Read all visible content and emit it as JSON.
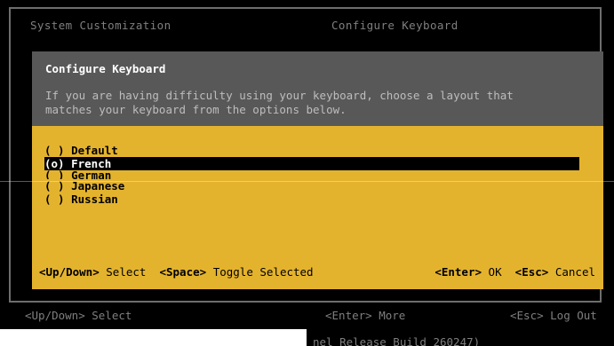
{
  "header": {
    "left_title": "System Customization",
    "right_title": "Configure Keyboard"
  },
  "dialog": {
    "title": "Configure Keyboard",
    "description_line1": "If you are having difficulty using your keyboard, choose a layout that",
    "description_line2": "matches your keyboard from the options below.",
    "options": [
      {
        "marker": "( )",
        "label": "Default",
        "selected": false
      },
      {
        "marker": "(o)",
        "label": "French",
        "selected": true
      },
      {
        "marker": "( )",
        "label": "German",
        "selected": false
      },
      {
        "marker": "( )",
        "label": "Japanese",
        "selected": false
      },
      {
        "marker": "( )",
        "label": "Russian",
        "selected": false
      }
    ],
    "help": {
      "updown_key": "<Up/Down>",
      "updown_action": "Select",
      "space_key": "<Space>",
      "space_action": "Toggle Selected",
      "enter_key": "<Enter>",
      "enter_action": "OK",
      "esc_key": "<Esc>",
      "esc_action": "Cancel"
    }
  },
  "footer": {
    "select_hint": "<Up/Down> Select",
    "more_hint": "<Enter> More",
    "logout_hint": "<Esc> Log Out",
    "build_text": "nel Release Build 260247)"
  },
  "colors": {
    "dialog_header_bg": "#585858",
    "dialog_body_bg": "#e4b32e",
    "selected_row_bg": "#000000"
  }
}
